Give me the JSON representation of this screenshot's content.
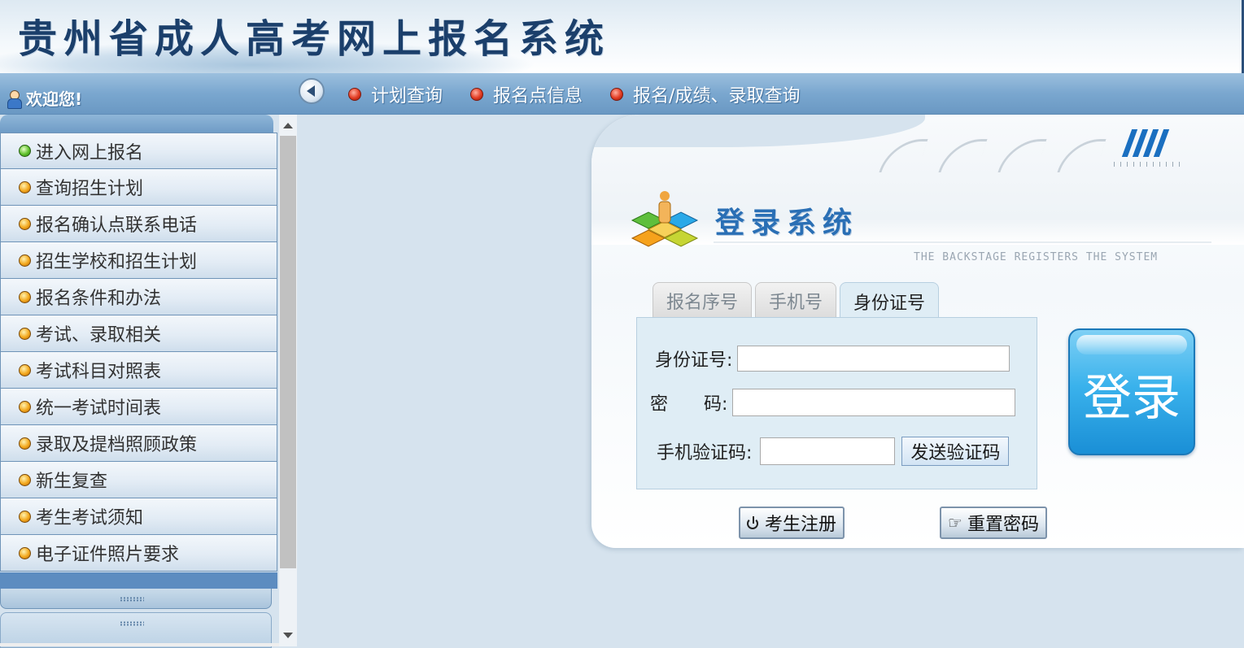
{
  "header": {
    "title": "贵州省成人高考网上报名系统"
  },
  "navbar": {
    "welcome": "欢迎您!",
    "links": [
      "计划查询",
      "报名点信息",
      "报名/成绩、录取查询"
    ]
  },
  "sidebar": {
    "items": [
      "进入网上报名",
      "查询招生计划",
      "报名确认点联系电话",
      "招生学校和招生计划",
      "报名条件和办法",
      "考试、录取相关",
      "考试科目对照表",
      "统一考试时间表",
      "录取及提档照顾政策",
      "新生复查",
      "考生考试须知",
      "电子证件照片要求"
    ]
  },
  "login": {
    "title": "登录系统",
    "subtitle": "THE BACKSTAGE REGISTERS THE SYSTEM",
    "tabs": [
      "报名序号",
      "手机号",
      "身份证号"
    ],
    "active_tab": "身份证号",
    "id_label": "身份证号:",
    "password_label": "密　　码:",
    "sms_label": "手机验证码:",
    "send_code": "发送验证码",
    "login_button": "登录",
    "register_button": "考生注册",
    "reset_button": "重置密码"
  },
  "colors": {
    "accent": "#2a6fb5",
    "nav": "#7aa7cf",
    "login_button": "#3ab2ec"
  },
  "icons": {
    "user": "user-icon",
    "back": "back-arrow-icon",
    "power": "power-icon",
    "hand": "pointing-hand-icon"
  }
}
